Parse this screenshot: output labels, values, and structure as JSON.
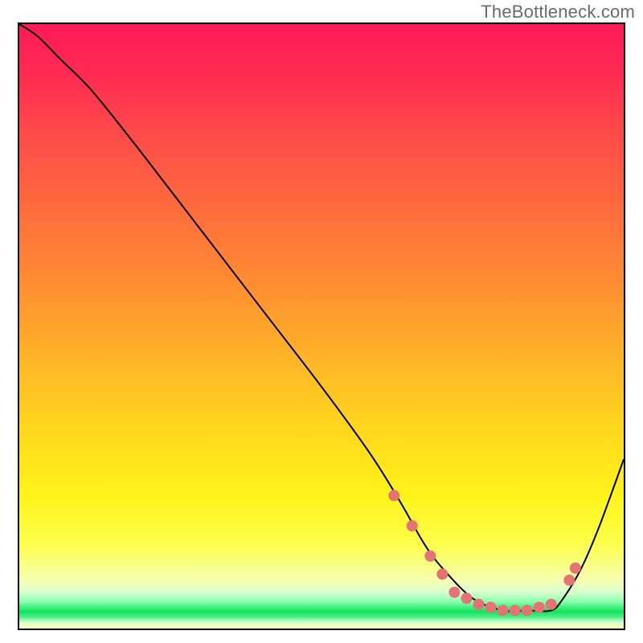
{
  "watermark": "TheBottleneck.com",
  "chart_data": {
    "type": "line",
    "title": "",
    "xlabel": "",
    "ylabel": "",
    "xlim": [
      0,
      100
    ],
    "ylim": [
      0,
      100
    ],
    "grid": false,
    "legend": false,
    "gradient_stops": [
      {
        "pct": 0,
        "color": "#ff1a58"
      },
      {
        "pct": 8,
        "color": "#ff2a52"
      },
      {
        "pct": 18,
        "color": "#ff4a4a"
      },
      {
        "pct": 30,
        "color": "#ff6a3e"
      },
      {
        "pct": 42,
        "color": "#ff8a32"
      },
      {
        "pct": 54,
        "color": "#ffb028"
      },
      {
        "pct": 66,
        "color": "#ffd41e"
      },
      {
        "pct": 78,
        "color": "#fff31a"
      },
      {
        "pct": 86,
        "color": "#fdff4a"
      },
      {
        "pct": 92,
        "color": "#f6ffb0"
      },
      {
        "pct": 94,
        "color": "#d8ffcf"
      },
      {
        "pct": 95.5,
        "color": "#8fffaf"
      },
      {
        "pct": 96.5,
        "color": "#3ef07f"
      },
      {
        "pct": 97.2,
        "color": "#18e060"
      },
      {
        "pct": 98,
        "color": "#3ef07f"
      },
      {
        "pct": 99,
        "color": "#d8ffcf"
      },
      {
        "pct": 100,
        "color": "#f6ffb0"
      }
    ],
    "series": [
      {
        "name": "bottleneck-curve",
        "x": [
          0,
          3,
          7,
          12,
          20,
          30,
          40,
          50,
          58,
          63,
          67,
          70,
          75,
          80,
          84,
          88,
          90,
          93,
          96,
          100
        ],
        "y": [
          100,
          98,
          94,
          89,
          79,
          66,
          53,
          40,
          29,
          21,
          14,
          10,
          5,
          3,
          3,
          3,
          5,
          10,
          17,
          28
        ],
        "color": "#000000",
        "stroke_width": 2
      }
    ],
    "markers": {
      "name": "highlight-dots",
      "color": "#e57373",
      "radius": 7,
      "points": [
        {
          "x": 62,
          "y": 22
        },
        {
          "x": 65,
          "y": 17
        },
        {
          "x": 68,
          "y": 12
        },
        {
          "x": 70,
          "y": 9
        },
        {
          "x": 72,
          "y": 6
        },
        {
          "x": 74,
          "y": 5
        },
        {
          "x": 76,
          "y": 4
        },
        {
          "x": 78,
          "y": 3.5
        },
        {
          "x": 80,
          "y": 3
        },
        {
          "x": 82,
          "y": 3
        },
        {
          "x": 84,
          "y": 3
        },
        {
          "x": 86,
          "y": 3.5
        },
        {
          "x": 88,
          "y": 4
        },
        {
          "x": 91,
          "y": 8
        },
        {
          "x": 92,
          "y": 10
        }
      ]
    }
  }
}
